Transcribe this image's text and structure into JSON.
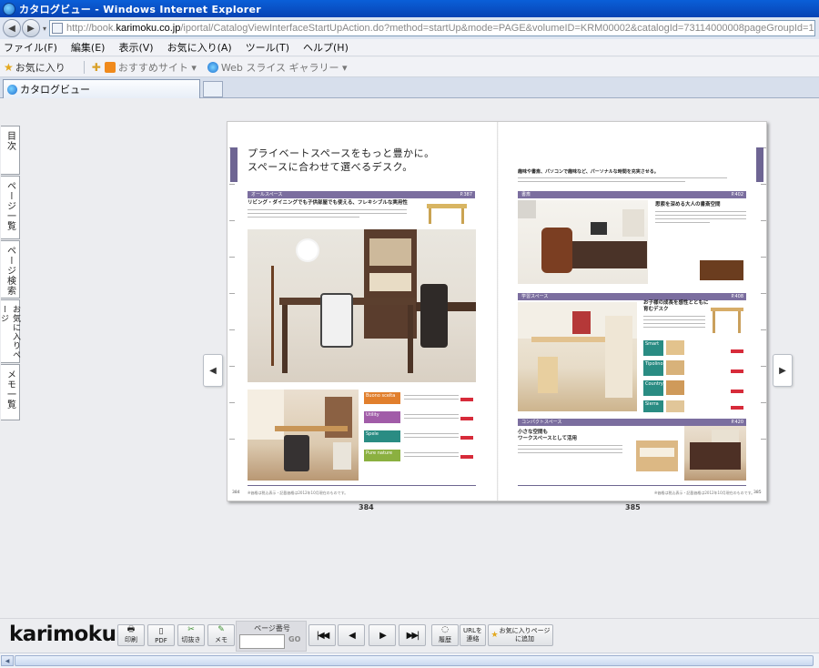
{
  "window": {
    "title": "カタログビュー - Windows Internet Explorer"
  },
  "address": {
    "prefix": "http://book.",
    "domain": "karimoku.co.jp",
    "rest": "/iportal/CatalogViewInterfaceStartUpAction.do?method=startUp&mode=PAGE&volumeID=KRM00002&catalogId=73114000008pageGroupId=193&designID=&designConfirmFlg="
  },
  "menu": [
    "ファイル(F)",
    "編集(E)",
    "表示(V)",
    "お気に入り(A)",
    "ツール(T)",
    "ヘルプ(H)"
  ],
  "favorites": {
    "label": "お気に入り",
    "suggested": "おすすめサイト ▾",
    "slices": "Web スライス ギャラリー ▾"
  },
  "tab": {
    "label": "カタログビュー"
  },
  "sidebar": {
    "items": [
      {
        "label": "目次"
      },
      {
        "label": "ページ一覧"
      },
      {
        "label": "ページ検索"
      },
      {
        "label": "お気に入りページ"
      },
      {
        "label": "メモ一覧"
      }
    ]
  },
  "catalog": {
    "headline_1": "プライベートスペースをもっと豊かに。",
    "headline_2": "スペースに合わせて選べるデスク。",
    "left": {
      "section_bar": "オールスペース",
      "section_ref": "P.387",
      "subhead": "リビング・ダイニングでも子供部屋でも使える、フレキシブルな実用性",
      "swatches": [
        "Buono scelta",
        "Utility",
        "Spele",
        "Pure nature"
      ],
      "page_number": "384",
      "footer_caption": "※価格は税込表示・記載価格は2012年10月現在のものです。"
    },
    "right": {
      "intro": "趣味や書斎、パソコンで趣味など、パーソナルな時間を充実させる。",
      "bar_1": "書斎",
      "bar_1_ref": "P.402",
      "sub_1": "思索を深める大人の書斎空間",
      "bar_2": "学習スペース",
      "bar_2_ref": "P.408",
      "sub_2a": "お子様の成長を感性とともに",
      "sub_2b": "育むデスク",
      "swatches": [
        "Smart",
        "Tipolino",
        "Country",
        "Sierra"
      ],
      "bar_3": "コンパクトスペース",
      "bar_3_ref": "P.420",
      "sub_3a": "小さな空間も",
      "sub_3b": "ワークスペースとして活用",
      "page_number": "385",
      "footer_caption": "※価格は税込表示・記載価格は2012年10月現在のものです。"
    },
    "page_label_left": "384",
    "page_label_right": "385"
  },
  "toolbar": {
    "logo": "karimoku",
    "print": "印刷",
    "pdf": "PDF",
    "clip": "切抜き",
    "memo": "メモ",
    "page_no_label": "ページ番号",
    "go": "GO",
    "history": "履歴",
    "url_link": "URLを\n連絡",
    "add_favorite": "お気に入りページ\nに追加"
  },
  "colors": {
    "accent": "#7b6e9f",
    "swatch_orange": "#e17f2d",
    "swatch_teal": "#2a8c83",
    "swatch_red": "#d72b3a",
    "swatch_green": "#8bb040"
  }
}
